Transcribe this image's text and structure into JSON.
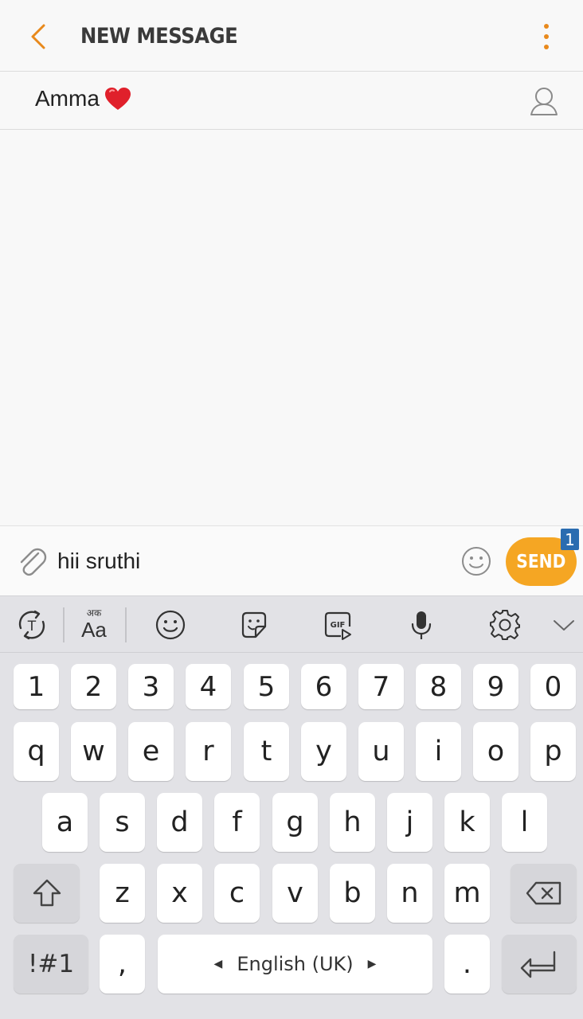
{
  "header": {
    "title": "NEW MESSAGE",
    "back_icon": "chevron-left-icon",
    "more_icon": "more-vertical-icon",
    "accent_color": "#e8891c"
  },
  "recipient": {
    "name": "Amma",
    "emoji": "❤️",
    "contact_icon": "person-outline-icon"
  },
  "compose": {
    "text": "hii sruthi",
    "attach_icon": "paperclip-icon",
    "emoji_icon": "smiley-icon",
    "send_label": "SEND",
    "send_color": "#f5a623",
    "badge": "1",
    "badge_color": "#2a6cb0"
  },
  "keyboard_toolbar": {
    "aa_small": "अक",
    "aa_big": "Aa",
    "items": [
      "text-prediction-icon",
      "language-aa-icon",
      "emoji-icon",
      "sticker-icon",
      "gif-icon",
      "microphone-icon",
      "settings-gear-icon",
      "collapse-chevron-icon"
    ]
  },
  "keyboard": {
    "numbers": [
      "1",
      "2",
      "3",
      "4",
      "5",
      "6",
      "7",
      "8",
      "9",
      "0"
    ],
    "row1": [
      "q",
      "w",
      "e",
      "r",
      "t",
      "y",
      "u",
      "i",
      "o",
      "p"
    ],
    "row2": [
      "a",
      "s",
      "d",
      "f",
      "g",
      "h",
      "j",
      "k",
      "l"
    ],
    "row3": [
      "z",
      "x",
      "c",
      "v",
      "b",
      "n",
      "m"
    ],
    "sym_label": "!#1",
    "comma": ",",
    "space_label": "English (UK)",
    "period": ".",
    "shift_icon": "shift-arrow-icon",
    "backspace_icon": "backspace-icon",
    "enter_icon": "enter-return-icon"
  }
}
